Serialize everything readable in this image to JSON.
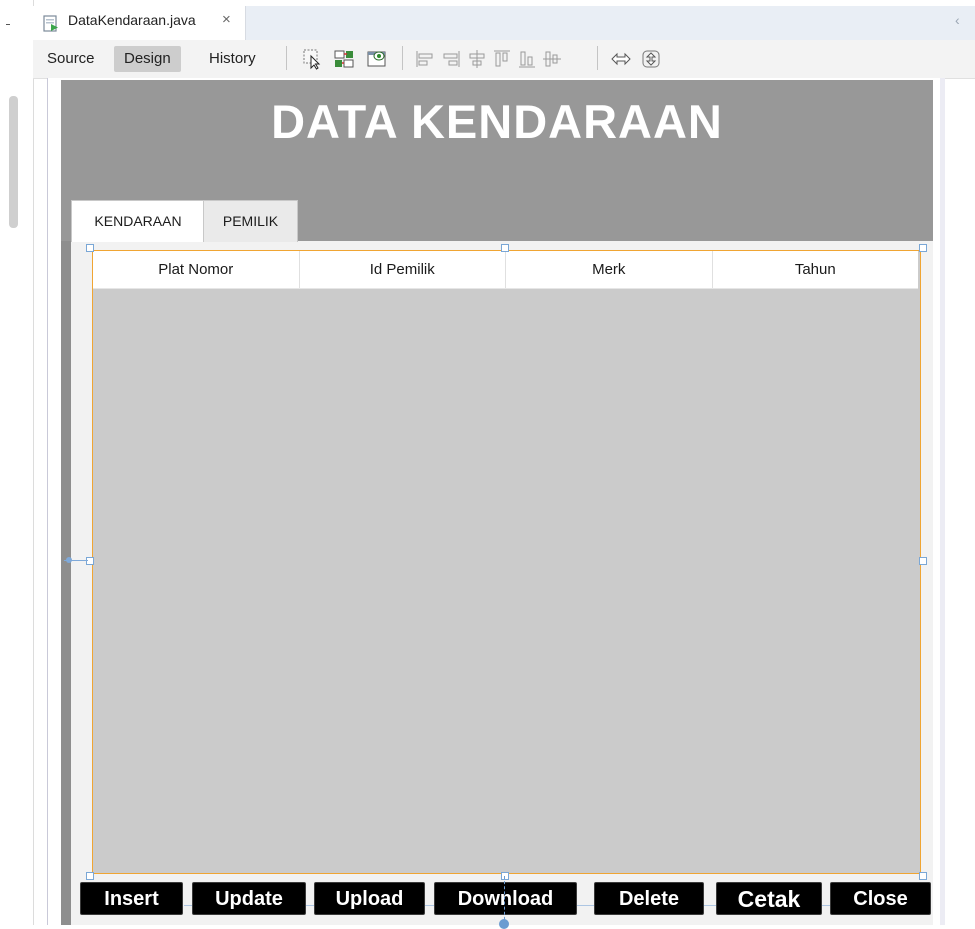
{
  "editor": {
    "tab_title": "DataKendaraan.java",
    "tab_close": "×",
    "scroll_left_glyph": "‹"
  },
  "toolbar": {
    "source_label": "Source",
    "design_label": "Design",
    "history_label": "History",
    "icons": [
      "selection-mode-icon",
      "connection-mode-icon",
      "preview-design-icon",
      "align-left-icon",
      "align-right-icon",
      "center-horizontal-icon",
      "align-top-icon",
      "align-bottom-icon",
      "center-vertical-icon",
      "horizontal-resize-icon",
      "vertical-resize-icon"
    ],
    "active_tab": "Design"
  },
  "form": {
    "title": "DATA KENDARAAN",
    "tabs": [
      {
        "label": "KENDARAAN",
        "selected": true
      },
      {
        "label": "PEMILIK",
        "selected": false
      }
    ],
    "table": {
      "columns": [
        "Plat Nomor",
        "Id Pemilik",
        "Merk",
        "Tahun"
      ],
      "rows": []
    },
    "buttons": {
      "insert": "Insert",
      "update": "Update",
      "upload": "Upload",
      "download": "Download",
      "delete": "Delete",
      "cetak": "Cetak",
      "close": "Close"
    }
  },
  "colors": {
    "header_bg": "#989898",
    "table_bg": "#cbcbcb",
    "selection_border": "#f0a533",
    "button_bg": "#000000"
  }
}
